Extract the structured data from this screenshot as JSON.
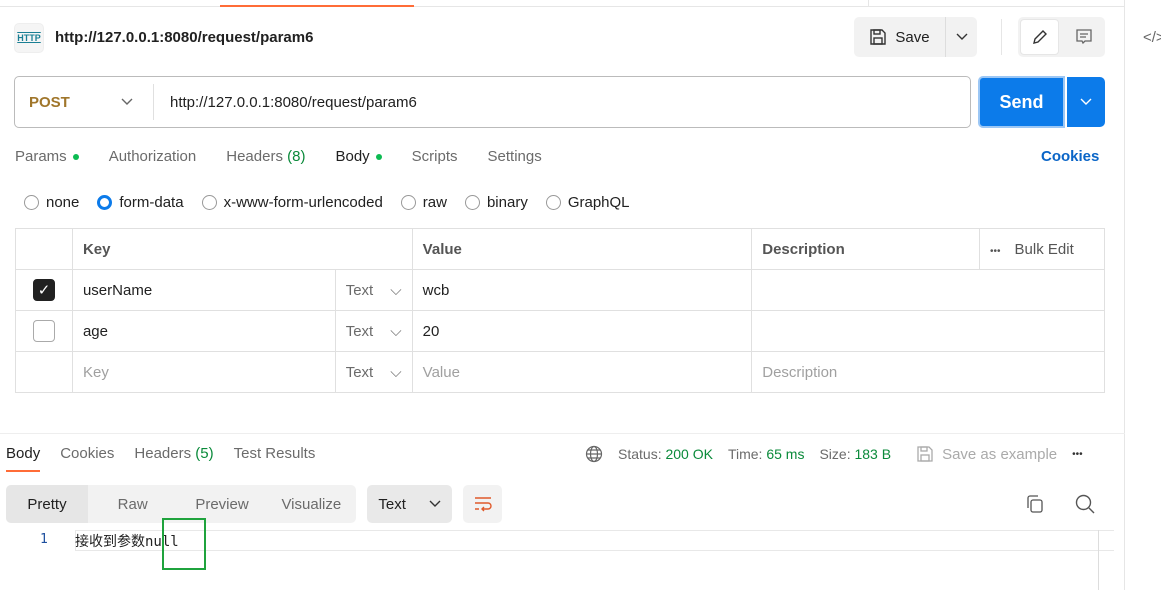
{
  "request": {
    "title": "http://127.0.0.1:8080/request/param6",
    "method": "POST",
    "url": "http://127.0.0.1:8080/request/param6",
    "icon_text": "HTTP"
  },
  "toolbar": {
    "save_label": "Save",
    "send_label": "Send",
    "code_icon": "</>"
  },
  "request_tabs": [
    {
      "label": "Params",
      "dot": true
    },
    {
      "label": "Authorization"
    },
    {
      "label": "Headers",
      "count": "(8)"
    },
    {
      "label": "Body",
      "dot": true,
      "active": true
    },
    {
      "label": "Scripts"
    },
    {
      "label": "Settings"
    }
  ],
  "cookies_label": "Cookies",
  "body_types": [
    {
      "label": "none"
    },
    {
      "label": "form-data",
      "selected": true
    },
    {
      "label": "x-www-form-urlencoded"
    },
    {
      "label": "raw"
    },
    {
      "label": "binary"
    },
    {
      "label": "GraphQL"
    }
  ],
  "table": {
    "headers": {
      "key": "Key",
      "value": "Value",
      "description": "Description",
      "bulk_edit": "Bulk Edit",
      "more": "•••"
    },
    "rows": [
      {
        "checked": true,
        "key": "userName",
        "type": "Text",
        "value": "wcb"
      },
      {
        "checked": false,
        "key": "age",
        "type": "Text",
        "value": "20"
      }
    ],
    "placeholder": {
      "key": "Key",
      "type": "Text",
      "value": "Value",
      "description": "Description"
    }
  },
  "response": {
    "tabs": [
      "Body",
      "Cookies",
      "Headers",
      "Test Results"
    ],
    "headers_count": "(5)",
    "status_label": "Status:",
    "status": "200 OK",
    "time_label": "Time:",
    "time": "65 ms",
    "size_label": "Size:",
    "size": "183 B",
    "save_example": "Save as example",
    "more": "•••",
    "formats": [
      "Pretty",
      "Raw",
      "Preview",
      "Visualize"
    ],
    "language": "Text",
    "line_number": "1",
    "body": "接收到参数null"
  },
  "colors": {
    "accent": "#ff6c37",
    "send": "#0c7bea",
    "method": "#a0762b",
    "success": "#0a8a3a",
    "highlight_box": "#1fa33d"
  }
}
